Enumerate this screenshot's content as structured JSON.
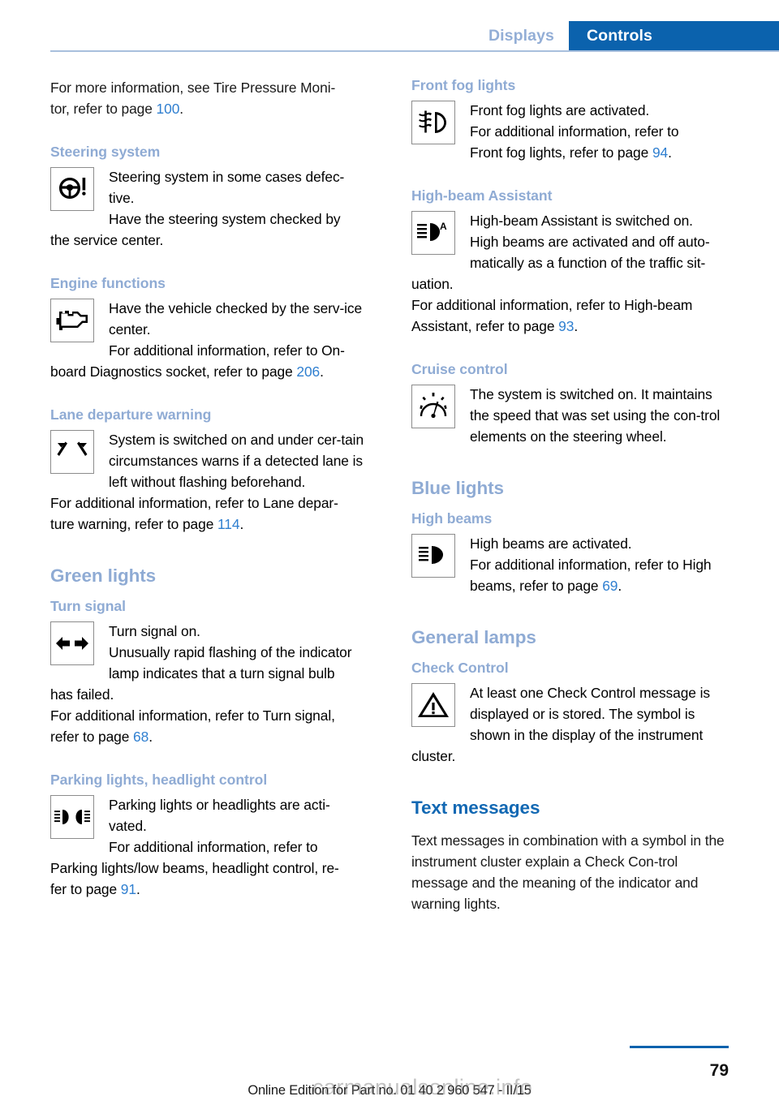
{
  "header": {
    "tab_inactive": "Displays",
    "tab_active": "Controls",
    "active_color": "#0b62ad",
    "inactive_color": "#93aed6"
  },
  "left_column": {
    "intro": {
      "text_before": "For more information, see Tire Pressure Moni-tor, refer to page ",
      "line1": "For more information, see Tire Pressure Moni-",
      "line2_prefix": "tor, refer to page ",
      "page_ref": "100",
      "line2_suffix": "."
    },
    "steering": {
      "heading": "Steering system",
      "icon": "steering-wheel-warning-icon",
      "text1": "Steering system in some cases defec-tive.",
      "text2": "Have the steering system checked by",
      "text3": "the service center."
    },
    "engine": {
      "heading": "Engine functions",
      "icon": "engine-check-icon",
      "text1": "Have the vehicle checked by the serv-ice center.",
      "text2": "For additional information, refer to On-",
      "text3_prefix": "board Diagnostics socket, refer to page ",
      "page_ref": "206",
      "text3_suffix": "."
    },
    "lane": {
      "heading": "Lane departure warning",
      "icon": "lane-departure-warning-icon",
      "text1": "System is switched on and under cer-tain circumstances warns if a detected lane is left without flashing beforehand.",
      "text2": "For additional information, refer to Lane depar-",
      "text3_prefix": "ture warning, refer to page ",
      "page_ref": "114",
      "text3_suffix": "."
    },
    "green_lights": {
      "heading": "Green lights"
    },
    "turn_signal": {
      "heading": "Turn signal",
      "icon": "turn-signal-arrows-icon",
      "text1": "Turn signal on.",
      "text2": "Unusually rapid flashing of the indicator lamp indicates that a turn signal bulb",
      "text3": "has failed.",
      "text4": "For additional information, refer to Turn signal,",
      "text5_prefix": "refer to page ",
      "page_ref": "68",
      "text5_suffix": "."
    },
    "parking_lights": {
      "heading": "Parking lights, headlight control",
      "icon": "parking-lights-icon",
      "text1": "Parking lights or headlights are acti-vated.",
      "text2": "For additional information, refer to",
      "text3": "Parking lights/low beams, headlight control, re-",
      "text4_prefix": "fer to page ",
      "page_ref": "91",
      "text4_suffix": "."
    }
  },
  "right_column": {
    "front_fog": {
      "heading": "Front fog lights",
      "icon": "front-fog-light-icon",
      "text1": "Front fog lights are activated.",
      "text2": "For additional information, refer to",
      "text3_prefix": "Front fog lights, refer to page ",
      "page_ref": "94",
      "text3_suffix": "."
    },
    "high_beam_assistant": {
      "heading": "High-beam Assistant",
      "icon": "high-beam-assistant-icon",
      "text1": "High-beam Assistant is switched on.",
      "text2": "High beams are activated and off auto-matically as a function of the traffic sit-",
      "text3": "uation.",
      "text4": "For additional information, refer to High-beam",
      "text5_prefix": "Assistant, refer to page ",
      "page_ref": "93",
      "text5_suffix": "."
    },
    "cruise_control": {
      "heading": "Cruise control",
      "icon": "cruise-control-gauge-icon",
      "text1": "The system is switched on. It maintains the speed that was set using the con-trol elements on the steering wheel."
    },
    "blue_lights": {
      "heading": "Blue lights"
    },
    "high_beams": {
      "heading": "High beams",
      "icon": "high-beam-icon",
      "text1": "High beams are activated.",
      "text2": "For additional information, refer to High",
      "text3_prefix": "beams, refer to page ",
      "page_ref": "69",
      "text3_suffix": "."
    },
    "general_lamps": {
      "heading": "General lamps"
    },
    "check_control": {
      "heading": "Check Control",
      "icon": "warning-triangle-icon",
      "text1": "At least one Check Control message is displayed or is stored. The symbol is shown in the display of the instrument",
      "text2": "cluster."
    },
    "text_messages": {
      "heading": "Text messages",
      "body": "Text messages in combination with a symbol in the instrument cluster explain a Check Con-trol message and the meaning of the indicator and warning lights."
    }
  },
  "footer": {
    "note": "Online Edition for Part no. 01 40 2 960 547 - II/15",
    "page_number": "79",
    "watermark": "carmanualsonline.info"
  }
}
